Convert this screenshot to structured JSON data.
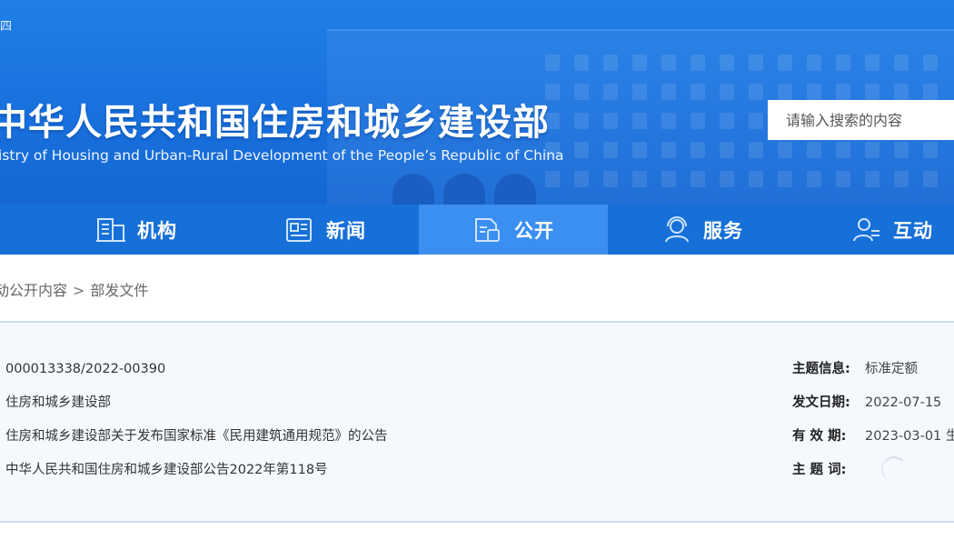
{
  "header": {
    "weekday": "四",
    "title": "中华人民共和国住房和城乡建设部",
    "subtitle": "istry of Housing and Urban-Rural Development of the People’s Republic of China",
    "search_placeholder": "请输入搜索的内容"
  },
  "nav": {
    "items": [
      {
        "label": "机构",
        "icon": "building-icon"
      },
      {
        "label": "新闻",
        "icon": "news-icon"
      },
      {
        "label": "公开",
        "icon": "document-icon",
        "active": true
      },
      {
        "label": "服务",
        "icon": "service-person-icon"
      },
      {
        "label": "互动",
        "icon": "interaction-person-icon"
      }
    ]
  },
  "breadcrumb": {
    "items": [
      "动公开内容",
      "部发文件"
    ],
    "separator": ">"
  },
  "info": {
    "left": [
      "000013338/2022-00390",
      "住房和城乡建设部",
      "住房和城乡建设部关于发布国家标准《民用建筑通用规范》的公告",
      "中华人民共和国住房和城乡建设部公告2022年第118号"
    ],
    "right": [
      {
        "label": "主题信息:",
        "value": "标准定额"
      },
      {
        "label": "发文日期:",
        "value": "2022-07-15"
      },
      {
        "label": "有 效 期:",
        "value": "2023-03-01 生"
      },
      {
        "label": "主 题 词:",
        "value": ""
      }
    ]
  },
  "colors": {
    "banner_blue": "#1a73e0",
    "nav_blue": "#1670d8",
    "nav_active": "#3b8ff0",
    "panel_bg": "#f5f9fe",
    "panel_border": "#c9dbf3"
  }
}
